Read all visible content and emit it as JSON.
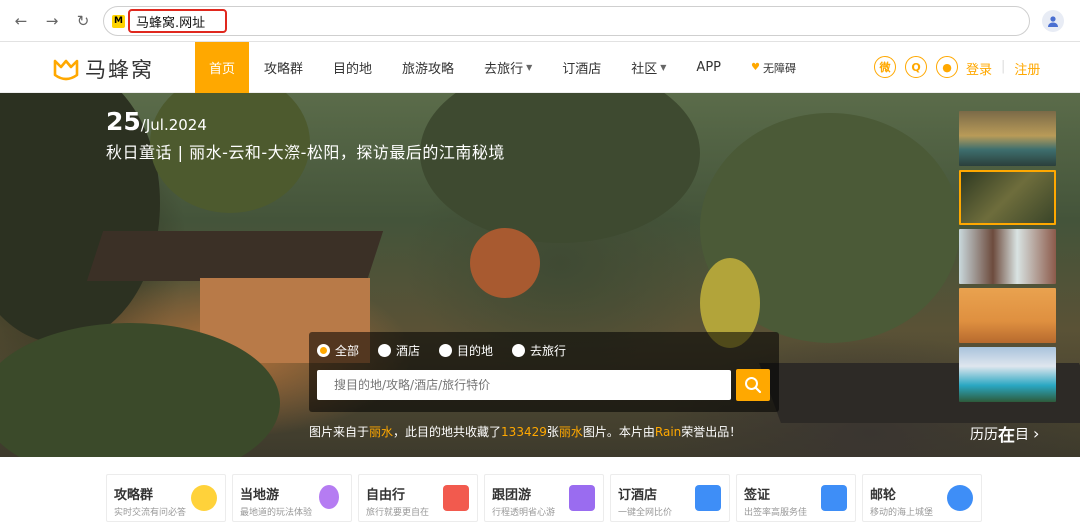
{
  "browser": {
    "url": "马蜂窝.网址",
    "favicon": "M"
  },
  "site": {
    "logo_text": "马蜂窝",
    "nav": [
      "首页",
      "攻略群",
      "目的地",
      "旅游攻略",
      "去旅行",
      "订酒店",
      "社区",
      "APP"
    ],
    "accessibility": "无障碍",
    "login": "登录",
    "register": "注册",
    "accent": "#ffa800"
  },
  "hero": {
    "date_day": "25",
    "date_rest": "/Jul.2024",
    "title": "秋日童话 | 丽水-云和-大漈-松阳，探访最后的江南秘境",
    "search": {
      "options": [
        "全部",
        "酒店",
        "目的地",
        "去旅行"
      ],
      "selected": "全部",
      "placeholder": "搜目的地/攻略/酒店/旅行特价"
    },
    "caption": {
      "p1": "图片来自于",
      "place": "丽水",
      "p2": "，此目的地共收藏了",
      "count": "133429",
      "p3": "张",
      "place2": "丽水",
      "p4": "图片。本片由",
      "author": "Rain",
      "p5": "荣誉出品！"
    },
    "history": {
      "pre": "历历",
      "big": "在",
      "post": "目"
    }
  },
  "cards": [
    {
      "title": "攻略群",
      "sub": "实时交流有问必答",
      "icon": "emoji-icon",
      "color": "#ffd23a"
    },
    {
      "title": "当地游",
      "sub": "最地道的玩法体验",
      "icon": "balloon-icon",
      "color": "#b57cf2"
    },
    {
      "title": "自由行",
      "sub": "旅行就要更自在",
      "icon": "gift-icon",
      "color": "#f25a4e"
    },
    {
      "title": "跟团游",
      "sub": "行程透明省心游",
      "icon": "flag-icon",
      "color": "#9a6cf0"
    },
    {
      "title": "订酒店",
      "sub": "一键全网比价",
      "icon": "hotel-icon",
      "color": "#3e8ef7"
    },
    {
      "title": "签证",
      "sub": "出签率高服务佳",
      "icon": "visa-icon",
      "color": "#3e8ef7"
    },
    {
      "title": "邮轮",
      "sub": "移动的海上城堡",
      "icon": "cruise-icon",
      "color": "#3e8ef7"
    }
  ]
}
